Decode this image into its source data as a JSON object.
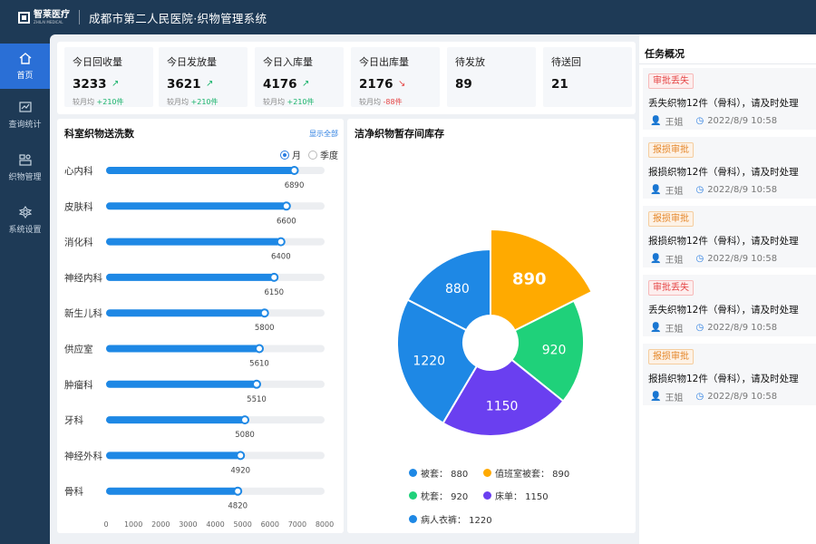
{
  "header": {
    "brand_name": "智莱医疗",
    "brand_sub": "ZHILAI MEDICAL",
    "title": "成都市第二人民医院·织物管理系统"
  },
  "sidebar": {
    "items": [
      {
        "label": "首页",
        "icon": "home-icon",
        "active": true
      },
      {
        "label": "查询统计",
        "icon": "chart-icon",
        "active": false
      },
      {
        "label": "织物管理",
        "icon": "grid-icon",
        "active": false
      },
      {
        "label": "系统设置",
        "icon": "settings-icon",
        "active": false
      }
    ]
  },
  "stats": [
    {
      "label": "今日回收量",
      "value": "3233",
      "trend": "↗",
      "compare": "较月均 +210件",
      "dir": "up"
    },
    {
      "label": "今日发放量",
      "value": "3621",
      "trend": "↗",
      "compare": "较月均 +210件",
      "dir": "up"
    },
    {
      "label": "今日入库量",
      "value": "4176",
      "trend": "↗",
      "compare": "较月均 +210件",
      "dir": "up"
    },
    {
      "label": "今日出库量",
      "value": "2176",
      "trend": "↘",
      "compare": "较月均 -88件",
      "dir": "down"
    },
    {
      "label": "待发放",
      "value": "89"
    },
    {
      "label": "待送回",
      "value": "21"
    }
  ],
  "bar_panel": {
    "title": "科室织物送洗数",
    "show_all": "显示全部",
    "options": [
      "月",
      "季度"
    ],
    "selected": "月"
  },
  "pie_panel": {
    "title": "洁净织物暂存间库存"
  },
  "task_panel": {
    "title": "任务概况",
    "tasks": [
      {
        "tag": "审批丢失",
        "tag_color": "red",
        "desc": "丢失织物12件（骨科），请及时处理",
        "user": "王姐",
        "time": "2022/8/9 10:58"
      },
      {
        "tag": "报损审批",
        "tag_color": "orange",
        "desc": "报损织物12件（骨科），请及时处理",
        "user": "王姐",
        "time": "2022/8/9 10:58"
      },
      {
        "tag": "报损审批",
        "tag_color": "orange",
        "desc": "报损织物12件（骨科），请及时处理",
        "user": "王姐",
        "time": "2022/8/9 10:58"
      },
      {
        "tag": "审批丢失",
        "tag_color": "red",
        "desc": "丢失织物12件（骨科），请及时处理",
        "user": "王姐",
        "time": "2022/8/9 10:58"
      },
      {
        "tag": "报损审批",
        "tag_color": "orange",
        "desc": "报损织物12件（骨科），请及时处理",
        "user": "王姐",
        "time": "2022/8/9 10:58"
      }
    ]
  },
  "colors": {
    "primary": "#1e88e5",
    "header": "#1e3a56",
    "up": "#19b36b",
    "down": "#e54545"
  },
  "chart_data": [
    {
      "type": "bar",
      "orientation": "horizontal",
      "title": "科室织物送洗数",
      "categories": [
        "心内科",
        "皮肤科",
        "消化科",
        "神经内科",
        "新生儿科",
        "供应室",
        "肿瘤科",
        "牙科",
        "神经外科",
        "骨科"
      ],
      "values": [
        6890,
        6600,
        6400,
        6150,
        5800,
        5610,
        5510,
        5080,
        4920,
        4820
      ],
      "xlim": [
        0,
        8000
      ],
      "xticks": [
        0,
        1000,
        2000,
        3000,
        4000,
        5000,
        6000,
        7000,
        8000
      ],
      "color": "#1e88e5"
    },
    {
      "type": "pie",
      "style": "donut",
      "title": "洁净织物暂存间库存",
      "slices": [
        {
          "name": "被套",
          "value": 880,
          "color": "#1e88e5"
        },
        {
          "name": "值班室被套",
          "value": 890,
          "color": "#ffaa00"
        },
        {
          "name": "枕套",
          "value": 920,
          "color": "#1fd17a"
        },
        {
          "name": "床单",
          "value": 1150,
          "color": "#6a3ff0"
        },
        {
          "name": "病人衣裤",
          "value": 1220,
          "color": "#1e88e5"
        }
      ],
      "highlighted": "值班室被套"
    }
  ]
}
